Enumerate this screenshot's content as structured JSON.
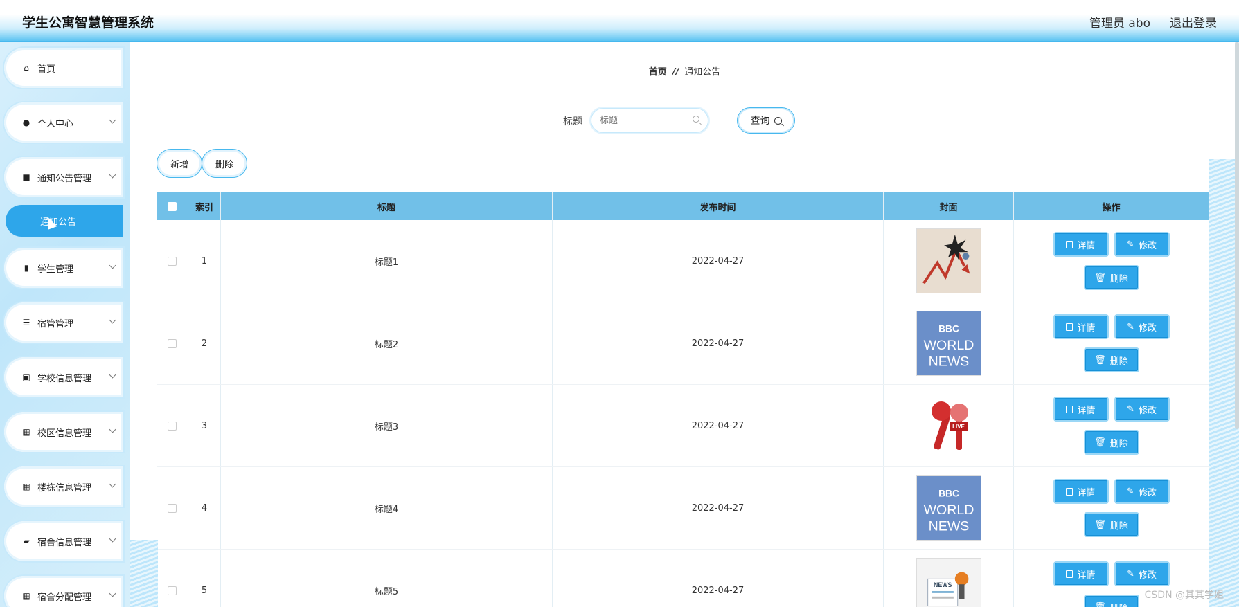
{
  "header": {
    "title": "学生公寓智慧管理系统",
    "admin": "管理员 abo",
    "logout": "退出登录"
  },
  "sidebar": {
    "items": [
      {
        "label": "首页",
        "icon": "home-icon"
      },
      {
        "label": "个人中心",
        "icon": "user-icon"
      },
      {
        "label": "通知公告管理",
        "icon": "briefcase-icon"
      },
      {
        "label": "学生管理",
        "icon": "clipboard-icon"
      },
      {
        "label": "宿管管理",
        "icon": "sliders-icon"
      },
      {
        "label": "学校信息管理",
        "icon": "chart-icon"
      },
      {
        "label": "校区信息管理",
        "icon": "grid-icon"
      },
      {
        "label": "楼栋信息管理",
        "icon": "grid-icon"
      },
      {
        "label": "宿舍信息管理",
        "icon": "wallet-icon"
      },
      {
        "label": "宿舍分配管理",
        "icon": "grid-icon"
      }
    ],
    "active_sub": "通知公告"
  },
  "breadcrumb": {
    "home": "首页",
    "sep": "//",
    "current": "通知公告"
  },
  "search": {
    "label": "标题",
    "placeholder": "标题",
    "button": "查询"
  },
  "actions": {
    "add": "新增",
    "delete": "删除"
  },
  "table": {
    "headers": [
      "索引",
      "标题",
      "发布时间",
      "封面",
      "操作"
    ],
    "rows": [
      {
        "index": "1",
        "title": "标题1",
        "date": "2022-04-27",
        "cover": "chart-crash"
      },
      {
        "index": "2",
        "title": "标题2",
        "date": "2022-04-27",
        "cover": "bbc-world-news"
      },
      {
        "index": "3",
        "title": "标题3",
        "date": "2022-04-27",
        "cover": "microphones"
      },
      {
        "index": "4",
        "title": "标题4",
        "date": "2022-04-27",
        "cover": "bbc-world-news"
      },
      {
        "index": "5",
        "title": "标题5",
        "date": "2022-04-27",
        "cover": "newspaper"
      }
    ],
    "ops": {
      "detail": "详情",
      "edit": "修改",
      "delete": "删除"
    }
  },
  "cover_text": {
    "bbc": "BBC",
    "world": "WORLD",
    "news": "NEWS",
    "live": "LIVE"
  },
  "watermark": "CSDN @其其学姐",
  "colors": {
    "accent": "#2ea6ea",
    "header_cell": "#71c0e8",
    "cover_bbc": "#6b8fc9"
  }
}
